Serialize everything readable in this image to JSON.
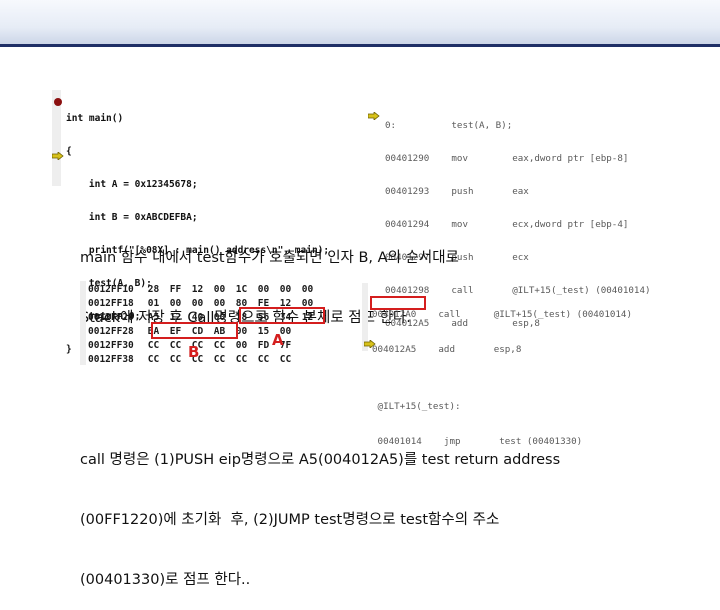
{
  "slide": {
    "caption1": [
      "main 함수 내에서 test함수가 호출되면 인자 B, A의 순서대로",
      "Stack에 저장 후 Call명령으로 함수 본체로 점프 한다."
    ],
    "caption2": [
      "call 명령은 (1)PUSH eip명령으로 A5(004012A5)를 test return address",
      "(00FF1220)에 초기화  후, (2)JUMP test명령으로 test함수의 주소",
      "(00401330)로 점프 한다.."
    ]
  },
  "source_code": {
    "lines": [
      "int main()",
      "{",
      "    int A = 0x12345678;",
      "    int B = 0xABCDEFBA;",
      "    printf(\"[%08X] : main() address\\n\", main);",
      "    test(A, B);",
      "    return 0;",
      "}"
    ]
  },
  "disasm_top": {
    "lines": [
      "0:          test(A, B);",
      "00401290    mov        eax,dword ptr [ebp-8]",
      "00401293    push       eax",
      "00401294    mov        ecx,dword ptr [ebp-4]",
      "00401297    push       ecx",
      "00401298    call       @ILT+15(_test) (00401014)",
      "004012A5    add        esp,8"
    ]
  },
  "memory": {
    "rows": [
      {
        "addr": "0012FF10",
        "bytes": [
          "28",
          "FF",
          "12",
          "00",
          "1C",
          "00",
          "00",
          "00"
        ]
      },
      {
        "addr": "0012FF18",
        "bytes": [
          "01",
          "00",
          "00",
          "00",
          "80",
          "FE",
          "12",
          "00"
        ]
      },
      {
        "addr": "0012FF20",
        "bytes": [
          "A5",
          "12",
          "40",
          "00",
          "78",
          "56",
          "34",
          "12"
        ]
      },
      {
        "addr": "0012FF28",
        "bytes": [
          "BA",
          "EF",
          "CD",
          "AB",
          "00",
          "15",
          "00",
          ""
        ]
      },
      {
        "addr": "0012FF30",
        "bytes": [
          "CC",
          "CC",
          "CC",
          "CC",
          "00",
          "FD",
          "7F",
          ""
        ]
      },
      {
        "addr": "0012FF38",
        "bytes": [
          "CC",
          "CC",
          "CC",
          "CC",
          "CC",
          "CC",
          "CC",
          ""
        ]
      }
    ],
    "label_a": "A",
    "label_b": "B"
  },
  "disasm_bottom": {
    "lines": [
      "004012A0    call      @ILT+15(_test) (00401014)",
      "004012A5    add       esp,8",
      "",
      " @ILT+15(_test):",
      " 00401014    jmp       test (00401330)"
    ]
  },
  "colors": {
    "highlight_red": "#d41e1e",
    "title_bar": "#1f2f66",
    "breakpoint": "#8b1010",
    "arrow": "#d8c21a"
  }
}
